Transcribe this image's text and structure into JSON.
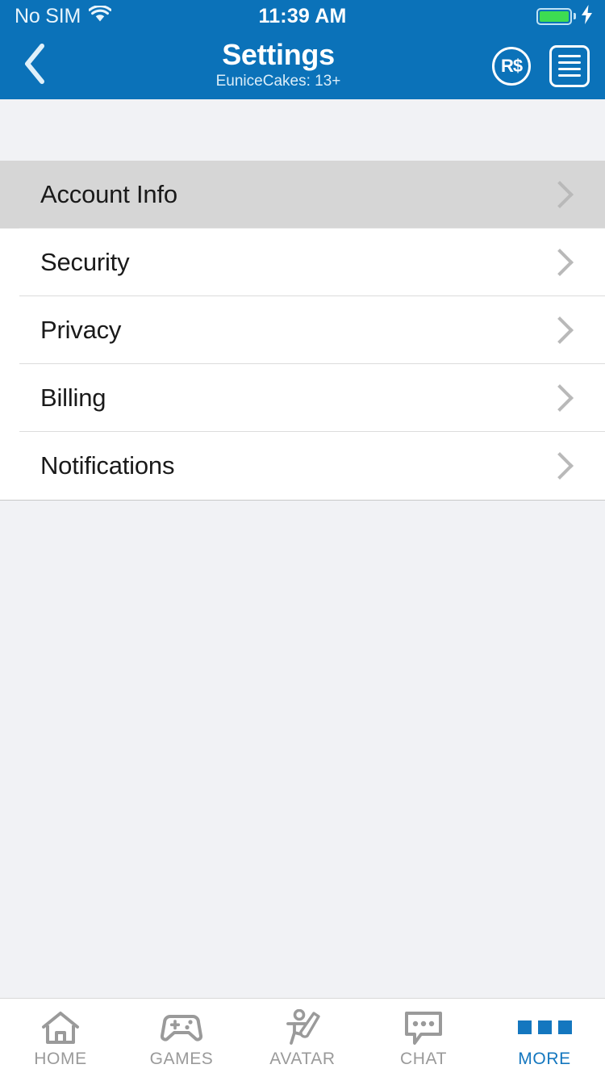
{
  "status_bar": {
    "carrier": "No SIM",
    "wifi_icon": "wifi-icon",
    "time": "11:39 AM",
    "battery_icon": "battery-full-icon",
    "charging_icon": "lightning-bolt-icon"
  },
  "header": {
    "back_icon": "chevron-left-icon",
    "title": "Settings",
    "subtitle": "EuniceCakes: 13+",
    "robux_label": "R$",
    "robux_icon": "robux-icon",
    "menu_icon": "hamburger-menu-icon"
  },
  "settings": {
    "rows": [
      {
        "label": "Account Info",
        "selected": true,
        "chevron": "chevron-right-icon"
      },
      {
        "label": "Security",
        "selected": false,
        "chevron": "chevron-right-icon"
      },
      {
        "label": "Privacy",
        "selected": false,
        "chevron": "chevron-right-icon"
      },
      {
        "label": "Billing",
        "selected": false,
        "chevron": "chevron-right-icon"
      },
      {
        "label": "Notifications",
        "selected": false,
        "chevron": "chevron-right-icon"
      }
    ]
  },
  "tab_bar": {
    "items": [
      {
        "label": "HOME",
        "icon": "home-icon",
        "active": false
      },
      {
        "label": "GAMES",
        "icon": "gamepad-icon",
        "active": false
      },
      {
        "label": "AVATAR",
        "icon": "avatar-icon",
        "active": false
      },
      {
        "label": "CHAT",
        "icon": "chat-bubble-icon",
        "active": false
      },
      {
        "label": "MORE",
        "icon": "more-dots-icon",
        "active": true
      }
    ]
  },
  "colors": {
    "header_blue": "#0b72b9",
    "accent_blue": "#1477bf",
    "selected_row": "#d6d6d6",
    "page_background": "#f1f2f5",
    "battery_green": "#3ddc52"
  }
}
